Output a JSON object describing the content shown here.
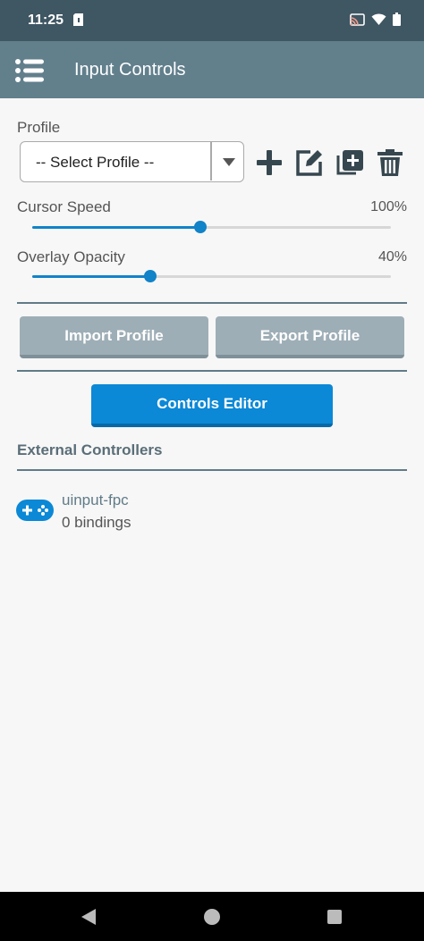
{
  "status": {
    "time": "11:25"
  },
  "appbar": {
    "title": "Input Controls"
  },
  "profile": {
    "label": "Profile",
    "selected": "-- Select Profile --"
  },
  "sliders": {
    "cursor_speed": {
      "label": "Cursor Speed",
      "value_text": "100%",
      "fraction": 0.47
    },
    "overlay_opacity": {
      "label": "Overlay Opacity",
      "value_text": "40%",
      "fraction": 0.33
    }
  },
  "buttons": {
    "import": "Import Profile",
    "export": "Export Profile",
    "controls_editor": "Controls Editor"
  },
  "external": {
    "title": "External Controllers",
    "controllers": [
      {
        "name": "uinput-fpc",
        "bindings": "0 bindings"
      }
    ]
  },
  "icons": {
    "menu": "menu-icon",
    "add": "plus-icon",
    "edit": "edit-icon",
    "duplicate": "duplicate-icon",
    "delete": "trash-icon",
    "controller": "gamepad-icon"
  },
  "colors": {
    "statusbar": "#3f5663",
    "appbar": "#627f8c",
    "accent": "#0b88d6",
    "gray_button": "#9eaeb6"
  }
}
